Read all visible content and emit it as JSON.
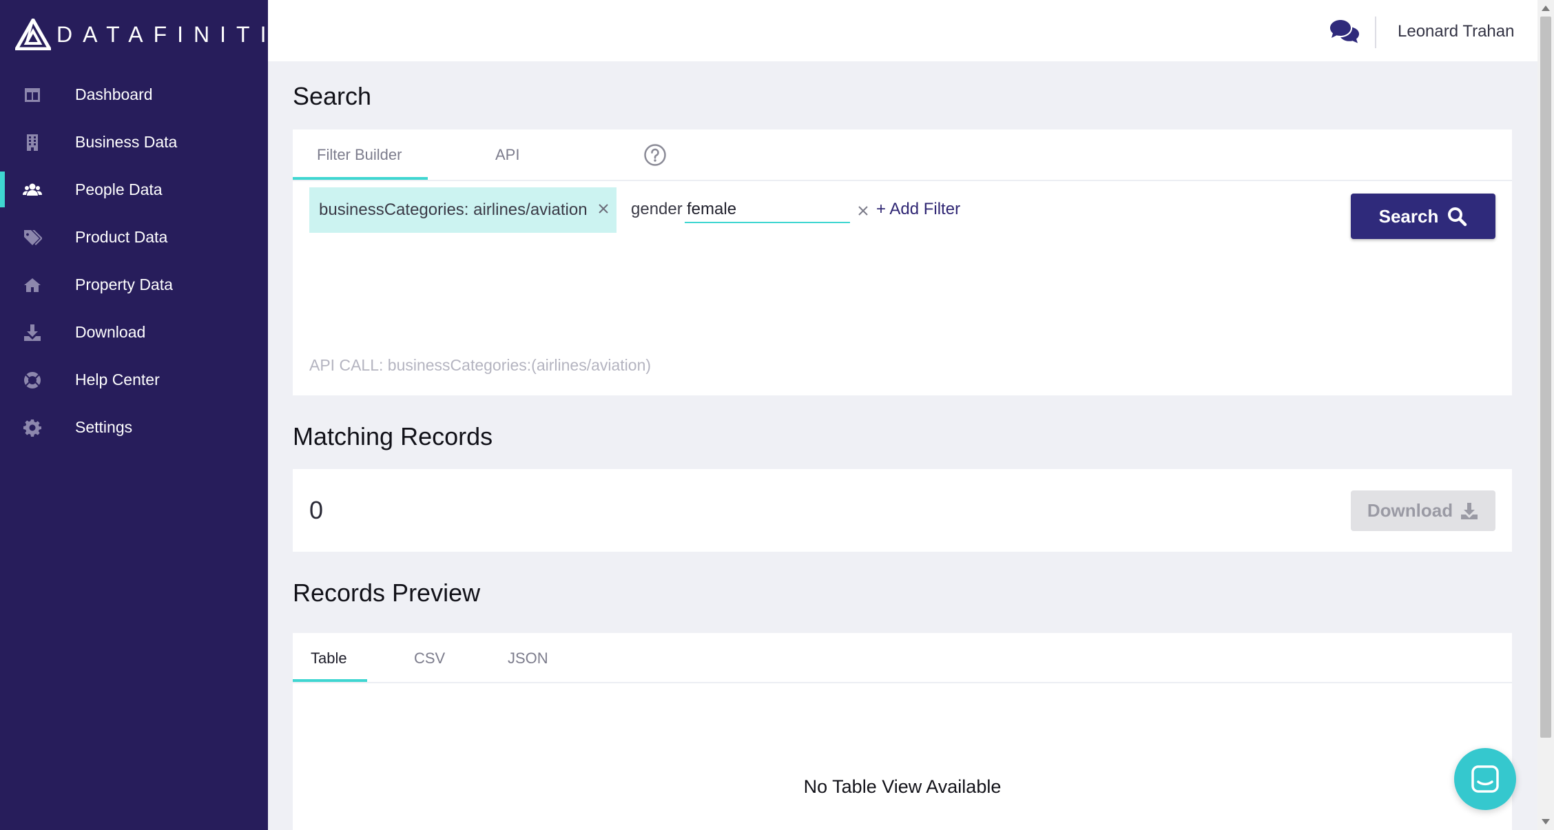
{
  "brand": {
    "name": "DATAFINITI"
  },
  "sidebar": {
    "items": [
      {
        "label": "Dashboard",
        "icon": "dashboard-icon",
        "active": false
      },
      {
        "label": "Business Data",
        "icon": "building-icon",
        "active": false
      },
      {
        "label": "People Data",
        "icon": "users-icon",
        "active": true
      },
      {
        "label": "Product Data",
        "icon": "tags-icon",
        "active": false
      },
      {
        "label": "Property Data",
        "icon": "home-icon",
        "active": false
      },
      {
        "label": "Download",
        "icon": "download-icon",
        "active": false
      },
      {
        "label": "Help Center",
        "icon": "life-ring-icon",
        "active": false
      },
      {
        "label": "Settings",
        "icon": "gear-icon",
        "active": false
      }
    ]
  },
  "header": {
    "user_name": "Leonard Trahan"
  },
  "search": {
    "title": "Search",
    "tabs": [
      "Filter Builder",
      "API"
    ],
    "active_tab": "Filter Builder",
    "chip": "businessCategories: airlines/aviation",
    "filter_field": "gender",
    "filter_value": "female",
    "add_filter": "+ Add Filter",
    "button": "Search",
    "api_call": "API CALL: businessCategories:(airlines/aviation)"
  },
  "matching": {
    "title": "Matching Records",
    "count": "0",
    "download_label": "Download"
  },
  "preview": {
    "title": "Records Preview",
    "tabs": [
      "Table",
      "CSV",
      "JSON"
    ],
    "active_tab": "Table",
    "empty_message": "No Table View Available"
  },
  "colors": {
    "sidebar_bg": "#271d5b",
    "accent": "#3fd6d1",
    "primary_button": "#2f2a7b",
    "page_bg": "#eff0f5",
    "chip_bg": "#ccf3f1"
  }
}
